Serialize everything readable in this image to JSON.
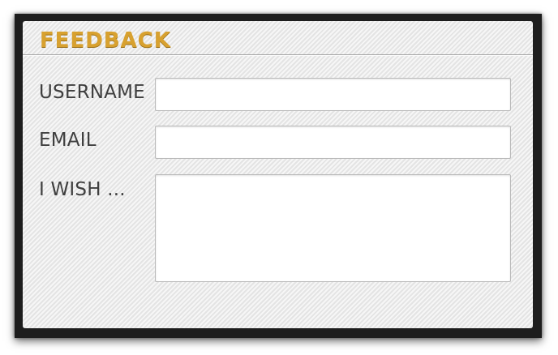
{
  "form": {
    "title": "FEEDBACK",
    "fields": [
      {
        "label": "USERNAME",
        "value": "",
        "placeholder": ""
      },
      {
        "label": "EMAIL",
        "value": "",
        "placeholder": ""
      },
      {
        "label": "I WISH ...",
        "value": "",
        "placeholder": ""
      }
    ]
  },
  "colors": {
    "title": "#d8a12f",
    "frame": "#1d1d1d",
    "panel": "#ececec",
    "label": "#3f3f3f"
  }
}
